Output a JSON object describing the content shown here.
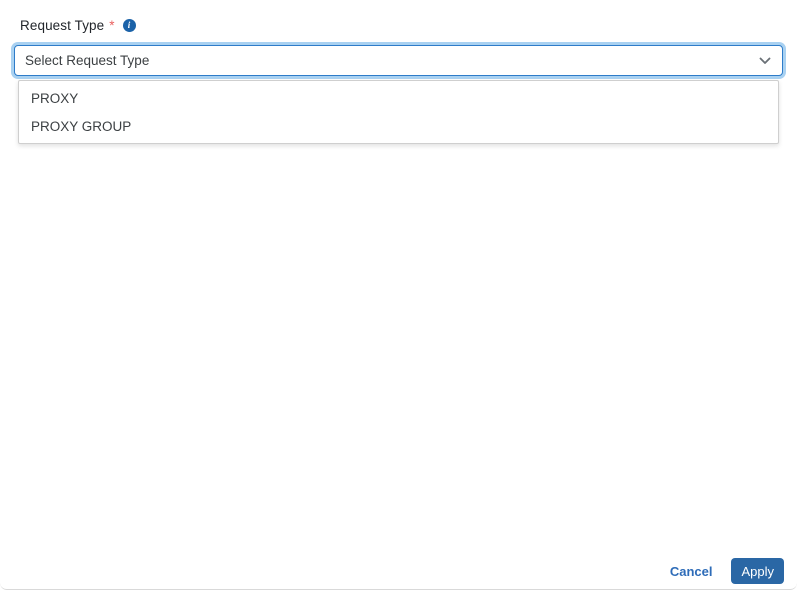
{
  "form": {
    "request_type": {
      "label": "Request Type",
      "required_marker": "*",
      "info_icon_glyph": "i",
      "placeholder": "Select Request Type",
      "options": [
        {
          "label": "PROXY"
        },
        {
          "label": "PROXY GROUP"
        }
      ]
    }
  },
  "footer": {
    "cancel_label": "Cancel",
    "apply_label": "Apply"
  },
  "colors": {
    "primary_blue": "#2a67a5",
    "cancel_blue": "#2e6cb8",
    "focus_border": "#2e7cc9",
    "focus_glow": "#a9d1f1",
    "required_red": "#e9605f",
    "info_blue": "#1b62a8",
    "chevron_gray": "#6a7076"
  }
}
